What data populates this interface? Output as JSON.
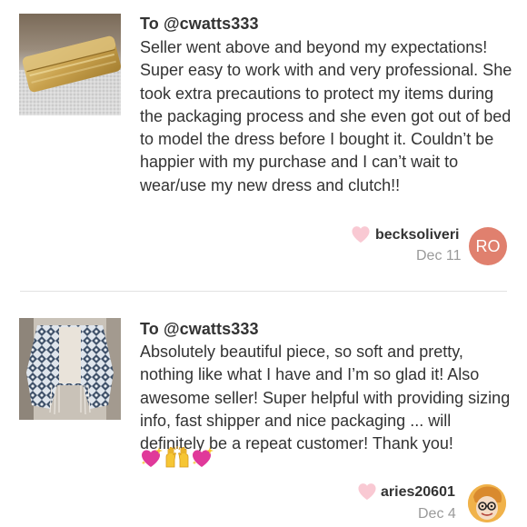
{
  "reviews": [
    {
      "recipient": "To @cwatts333",
      "text": "Seller went above and beyond my expectations! Super easy to work with and very professional. She took extra precautions to protect my items during the packaging process and she even got out of bed to model the dress before I bought it. Couldn’t be happier with my purchase and I can’t wait to wear/use my new dress and clutch!!",
      "username": "becksoliveri",
      "date": "Dec 11",
      "avatar_initials": "RO",
      "avatar_color": "#e0806e",
      "thumbnail": "gold-clutch-photo"
    },
    {
      "recipient": "To @cwatts333",
      "text": "Absolutely beautiful piece, so soft and pretty, nothing like what I have and I’m so glad it! Also awesome seller! Super helpful with providing sizing info, fast shipper and nice packaging ... will definitely be a repeat customer! Thank you!",
      "emojis": [
        "sparkling-heart",
        "raising-hands",
        "sparkling-heart"
      ],
      "username": "aries20601",
      "date": "Dec 4",
      "thumbnail": "patterned-kimono-photo",
      "avatar": "cartoon-face-avatar"
    }
  ],
  "colors": {
    "heart": "#f9c9d3",
    "text": "#333333",
    "muted": "#9a9a9a",
    "divider": "#e2e2e2"
  }
}
